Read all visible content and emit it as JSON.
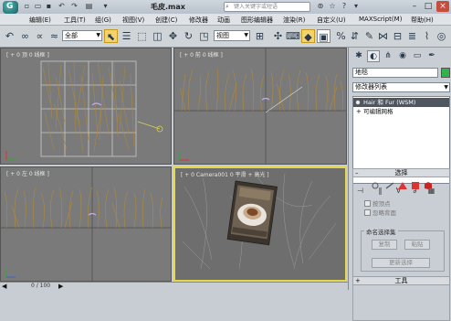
{
  "title_bar": {
    "app_icon_letter": "G",
    "document_title": "毛皮.max",
    "search_placeholder": "键入关键字或短语",
    "window_controls": [
      "minimize-icon",
      "restore-icon",
      "close-icon"
    ]
  },
  "menu": [
    "编辑(E)",
    "工具(T)",
    "组(G)",
    "视图(V)",
    "创建(C)",
    "修改器",
    "动画",
    "图形编辑器",
    "渲染(R)",
    "自定义(U)",
    "MAXScript(M)",
    "帮助(H)"
  ],
  "toolbar": {
    "selection_filter": "全部",
    "reference_coord": "视图"
  },
  "viewports": [
    {
      "label": "[ + 0 顶 0 线框 ]"
    },
    {
      "label": "[ + 0 前 0 线框 ]"
    },
    {
      "label": "[ + 0 左 0 线框 ]"
    },
    {
      "label": "[ + 0 Camera001 0 平滑 + 高光 ]"
    }
  ],
  "command_panel": {
    "object_name": "地毯",
    "object_color": "#2fb34a",
    "modifier_list_label": "修改器列表",
    "stack": [
      "Hair 和 Fur (WSM)",
      "可编辑网格"
    ],
    "rollout_selection": "选择",
    "checkbox_by_vertex": "按顶点",
    "checkbox_ignore_backface": "忽略背面",
    "named_sets_title": "命名选择集",
    "copy_button": "复制",
    "paste_button": "粘贴",
    "update_selection_button": "更新选择",
    "rollout_tools": "工具"
  },
  "status_bar": {
    "frame_counter": "0 / 100"
  }
}
